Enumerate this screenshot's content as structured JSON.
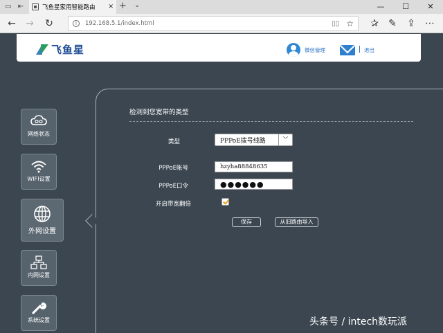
{
  "browser": {
    "tab_title": "飞鱼星家用智能路由",
    "url": "192.168.5.1/index.html"
  },
  "header": {
    "logo_text": "飞鱼星",
    "wechat_label": "微信管理",
    "logout_label": "退出",
    "brand_blue": "#1f4e96",
    "link_blue": "#3176c7"
  },
  "sidebar": {
    "items": [
      {
        "label": "网络状态",
        "icon": "cloud-icon"
      },
      {
        "label": "WIFI设置",
        "icon": "wifi-icon"
      },
      {
        "label": "外网设置",
        "icon": "globe-icon",
        "active": true
      },
      {
        "label": "内网设置",
        "icon": "network-icon"
      },
      {
        "label": "系统设置",
        "icon": "wrench-icon"
      }
    ]
  },
  "main": {
    "section_title": "检测到您宽带的类型",
    "type_label": "类型",
    "type_value": "PPPoE拨号线路",
    "account_label": "PPPoE帐号",
    "account_value": "hzyha88848635",
    "password_label": "PPPoE口令",
    "password_mask": "●●●●●●",
    "boost_label": "开启带宽翻倍",
    "boost_checked": true,
    "save_label": "保存",
    "import_label": "从旧路由导入"
  },
  "watermark": "头条号 / intech数玩派",
  "colors": {
    "page_bg": "#3b4650",
    "checkbox_tick": "#e8a020"
  }
}
